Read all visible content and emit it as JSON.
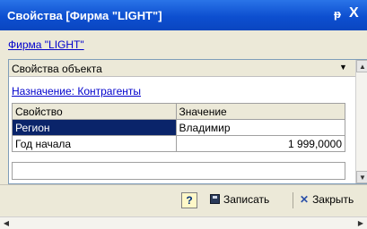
{
  "window": {
    "title": "Свойства [Фирма \"LIGHT\"]",
    "pin_glyph": "⁴",
    "close_glyph": "X"
  },
  "object_link": "Фирма \"LIGHT\"",
  "panel": {
    "title": "Свойства объекта",
    "dropdown_glyph": "▼",
    "purpose_link": "Назначение: Контрагенты",
    "columns": [
      "Свойство",
      "Значение"
    ],
    "rows": [
      {
        "property": "Регион",
        "value": "Владимир",
        "selected": true
      },
      {
        "property": "Год начала",
        "value": "1 999,0000",
        "selected": false
      }
    ]
  },
  "toolbar": {
    "help_label": "?",
    "save_label": "Записать",
    "close_label": "Закрыть"
  },
  "scroll": {
    "up_glyph": "▲",
    "down_glyph": "▼",
    "left_glyph": "◀",
    "right_glyph": "▶"
  },
  "colors": {
    "titlebar": "#0d4fd0",
    "selection": "#0a246a",
    "link": "#0000cc",
    "face": "#ece9d8"
  }
}
